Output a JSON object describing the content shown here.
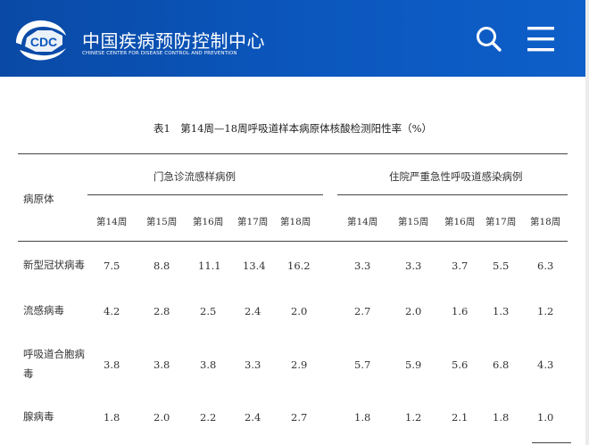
{
  "header": {
    "logo_text": "CDC",
    "title_cn": "中国疾病预防控制中心",
    "title_en": "CHINESE CENTER FOR DISEASE CONTROL AND PREVENTION",
    "search_icon": "search-icon",
    "menu_icon": "hamburger-menu-icon",
    "bg_color": "#0b57be"
  },
  "table": {
    "caption": "表1　第14周—18周呼吸道样本病原体核酸检测阳性率（%）",
    "col_header_pathogen": "病原体",
    "group1": "门急诊流感样病例",
    "group2": "住院严重急性呼吸道感染病例",
    "weeks": [
      "第14周",
      "第15周",
      "第16周",
      "第17周",
      "第18周"
    ],
    "rows": [
      {
        "name": "新型冠状病毒",
        "g1": [
          "7.5",
          "8.8",
          "11.1",
          "13.4",
          "16.2"
        ],
        "g2": [
          "3.3",
          "3.3",
          "3.7",
          "5.5",
          "6.3"
        ]
      },
      {
        "name": "流感病毒",
        "g1": [
          "4.2",
          "2.8",
          "2.5",
          "2.4",
          "2.0"
        ],
        "g2": [
          "2.7",
          "2.0",
          "1.6",
          "1.3",
          "1.2"
        ]
      },
      {
        "name": "呼吸道合胞病毒",
        "g1": [
          "3.8",
          "3.8",
          "3.8",
          "3.3",
          "2.9"
        ],
        "g2": [
          "5.7",
          "5.9",
          "5.6",
          "6.8",
          "4.3"
        ]
      },
      {
        "name": "腺病毒",
        "g1": [
          "1.8",
          "2.0",
          "2.2",
          "2.4",
          "2.7"
        ],
        "g2": [
          "1.8",
          "1.2",
          "2.1",
          "1.8",
          "1.0"
        ]
      }
    ]
  }
}
